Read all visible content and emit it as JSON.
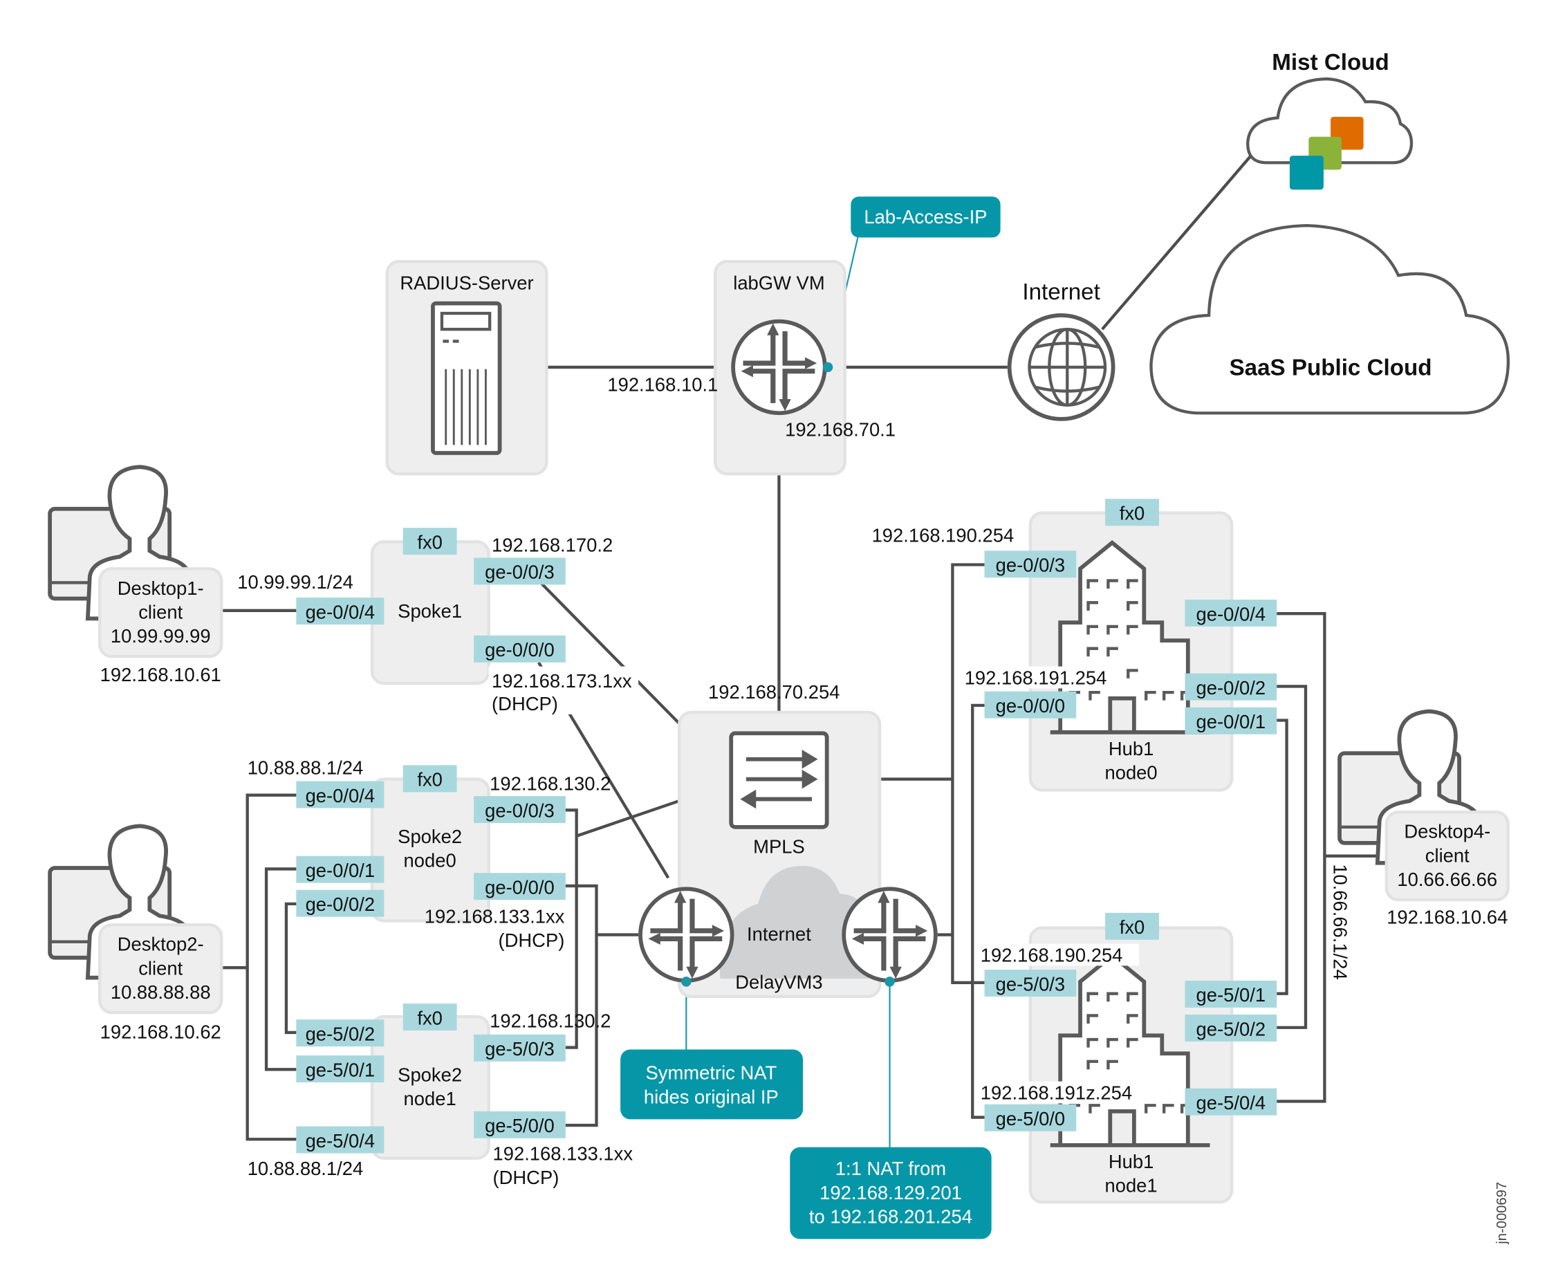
{
  "diagram_id": "jn-000697",
  "colors": {
    "port": "#a8d8de",
    "callout": "#0597a8",
    "box": "#eeeeee",
    "line": "#4d4d4d",
    "mist_teal": "#0097a7",
    "mist_green": "#8bb33a",
    "mist_orange": "#e06c00"
  },
  "clouds": {
    "mist": "Mist Cloud",
    "saas": "SaaS Public Cloud",
    "internet": "Internet"
  },
  "radius": {
    "title": "RADIUS-Server"
  },
  "labgw": {
    "title": "labGW VM",
    "ip_left": "192.168.10.1",
    "ip_down": "192.168.70.1",
    "callout": "Lab-Access-IP"
  },
  "desktop1": {
    "line1": "Desktop1-",
    "line2": "client",
    "ip": "10.99.99.99",
    "mgmt": "192.168.10.61"
  },
  "desktop2": {
    "line1": "Desktop2-",
    "line2": "client",
    "ip": "10.88.88.88",
    "mgmt": "192.168.10.62"
  },
  "desktop4": {
    "line1": "Desktop4-",
    "line2": "client",
    "ip": "10.66.66.66",
    "mgmt": "192.168.10.64",
    "subnet": "10.66.66.1/24"
  },
  "spoke1": {
    "name": "Spoke1",
    "fx": "fx0",
    "p_lan": "ge-0/0/4",
    "p_mpls": "ge-0/0/3",
    "p_inet": "ge-0/0/0",
    "lan_ip": "10.99.99.1/24",
    "mpls_ip": "192.168.170.2",
    "inet_ip": "192.168.173.1xx",
    "dhcp": "(DHCP)"
  },
  "spoke2n0": {
    "line1": "Spoke2",
    "line2": "node0",
    "fx": "fx0",
    "p_lan": "ge-0/0/4",
    "p1": "ge-0/0/1",
    "p2": "ge-0/0/2",
    "p_mpls": "ge-0/0/3",
    "p_inet": "ge-0/0/0",
    "lan_ip": "10.88.88.1/24",
    "mpls_ip": "192.168.130.2",
    "inet_ip": "192.168.133.1xx",
    "dhcp": "(DHCP)"
  },
  "spoke2n1": {
    "line1": "Spoke2",
    "line2": "node1",
    "fx": "fx0",
    "p_lan": "ge-5/0/4",
    "p1": "ge-5/0/1",
    "p2": "ge-5/0/2",
    "p_mpls": "ge-5/0/3",
    "p_inet": "ge-5/0/0",
    "lan_ip": "10.88.88.1/24",
    "mpls_ip": "192.168.130.2",
    "inet_ip": "192.168.133.1xx",
    "dhcp": "(DHCP)"
  },
  "mpls": {
    "name": "MPLS",
    "ip": "192.168.70.254",
    "internet": "Internet",
    "delay": "DelayVM3"
  },
  "hub1n0": {
    "line1": "Hub1",
    "line2": "node0",
    "fx": "fx0",
    "p3": "ge-0/0/3",
    "p0": "ge-0/0/0",
    "p4": "ge-0/0/4",
    "p2": "ge-0/0/2",
    "p1": "ge-0/0/1",
    "ip3": "192.168.190.254",
    "ip0": "192.168.191.254"
  },
  "hub1n1": {
    "line1": "Hub1",
    "line2": "node1",
    "fx": "fx0",
    "p3": "ge-5/0/3",
    "p0": "ge-5/0/0",
    "p4": "ge-5/0/4",
    "p2": "ge-5/0/2",
    "p1": "ge-5/0/1",
    "ip3": "192.168.190.254",
    "ip0": "192.168.191z.254"
  },
  "callouts": {
    "symnat": [
      "Symmetric NAT",
      "hides original IP"
    ],
    "nat11": [
      "1:1 NAT from",
      "192.168.129.201",
      "to 192.168.201.254"
    ]
  }
}
